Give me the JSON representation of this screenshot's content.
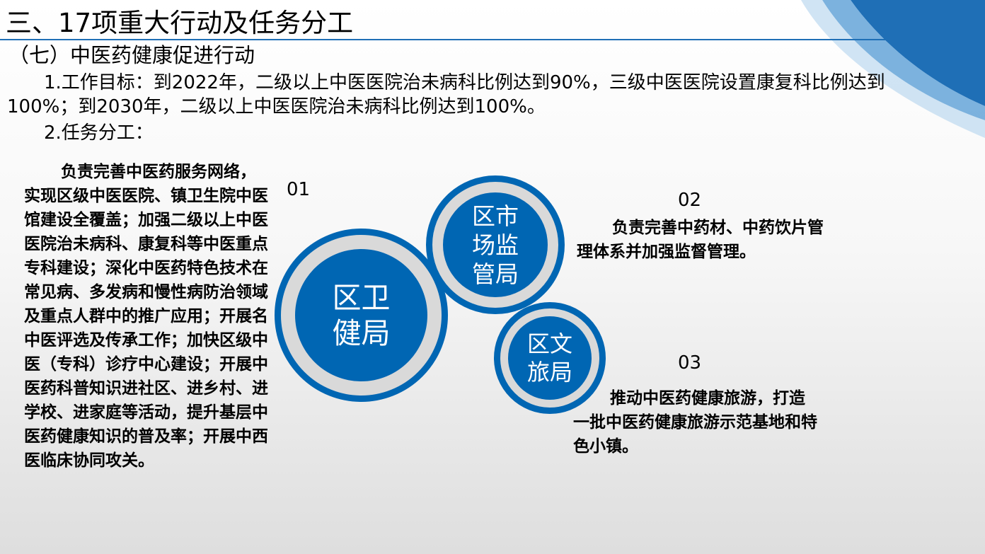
{
  "header": {
    "title": "三、17项重大行动及任务分工",
    "subtitle": "（七）中医药健康促进行动"
  },
  "goal_text": "1.工作目标：到2022年，二级以上中医医院治未病科比例达到90%，三级中医医院设置康复科比例达到100%；到2030年，二级以上中医医院治未病科比例达到100%。",
  "task_label": "2.任务分工：",
  "tasks": [
    {
      "number": "01",
      "agency": "区卫\n健局",
      "description": "负责完善中医药服务网络，实现区级中医医院、镇卫生院中医馆建设全覆盖；加强二级以上中医医院治未病科、康复科等中医重点专科建设；深化中医药特色技术在常见病、多发病和慢性病防治领域及重点人群中的推广应用；开展名中医评选及传承工作；加快区级中医（专科）诊疗中心建设；开展中医药科普知识进社区、进乡村、进学校、进家庭等活动，提升基层中医药健康知识的普及率；开展中西医临床协同攻关。"
    },
    {
      "number": "02",
      "agency": "区市\n场监\n管局",
      "description": "负责完善中药材、中药饮片管理体系并加强监督管理。"
    },
    {
      "number": "03",
      "agency": "区文\n旅局",
      "description": "推动中医药健康旅游，打造一批中医药健康旅游示范基地和特色小镇。"
    }
  ],
  "colors": {
    "accent_blue": "#0066b3",
    "ring_gray": "#d9d9d9"
  }
}
